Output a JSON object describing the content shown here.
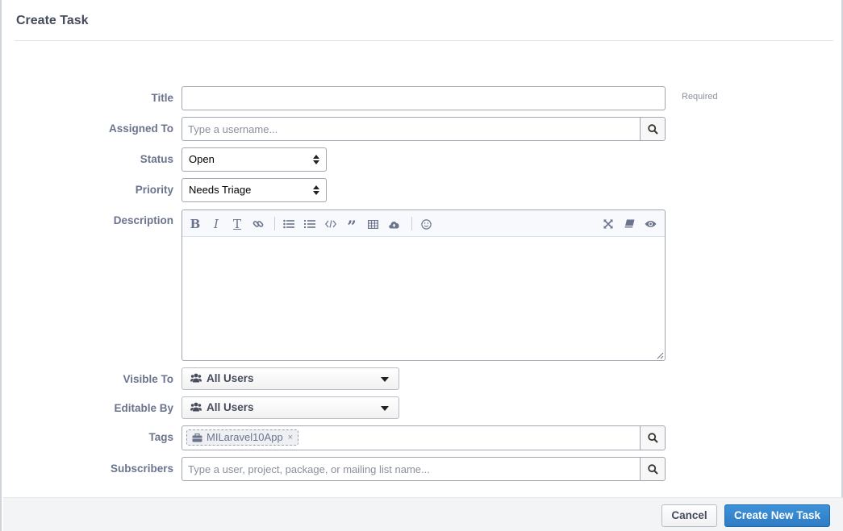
{
  "dialog": {
    "title": "Create Task"
  },
  "form": {
    "title": {
      "label": "Title",
      "value": "",
      "hint": "Required"
    },
    "assigned_to": {
      "label": "Assigned To",
      "placeholder": "Type a username..."
    },
    "status": {
      "label": "Status",
      "value": "Open"
    },
    "priority": {
      "label": "Priority",
      "value": "Needs Triage"
    },
    "description": {
      "label": "Description",
      "value": ""
    },
    "visible_to": {
      "label": "Visible To",
      "value": "All Users"
    },
    "editable_by": {
      "label": "Editable By",
      "value": "All Users"
    },
    "tags": {
      "label": "Tags",
      "tokens": [
        {
          "label": "MILaravel10App",
          "remove": "×"
        }
      ]
    },
    "subscribers": {
      "label": "Subscribers",
      "placeholder": "Type a user, project, package, or mailing list name..."
    }
  },
  "toolbar": {
    "icons": [
      "bold-icon",
      "italic-icon",
      "text-size-icon",
      "link-icon",
      "bullet-list-icon",
      "numbered-list-icon",
      "code-icon",
      "quote-icon",
      "table-icon",
      "upload-icon",
      "emoji-icon",
      "fullscreen-icon",
      "reference-icon",
      "preview-icon"
    ]
  },
  "footer": {
    "cancel_label": "Cancel",
    "submit_label": "Create New Task"
  },
  "colors": {
    "label": "#6b748c",
    "primary": "#3e92d8",
    "border": "#a1a6b0"
  }
}
